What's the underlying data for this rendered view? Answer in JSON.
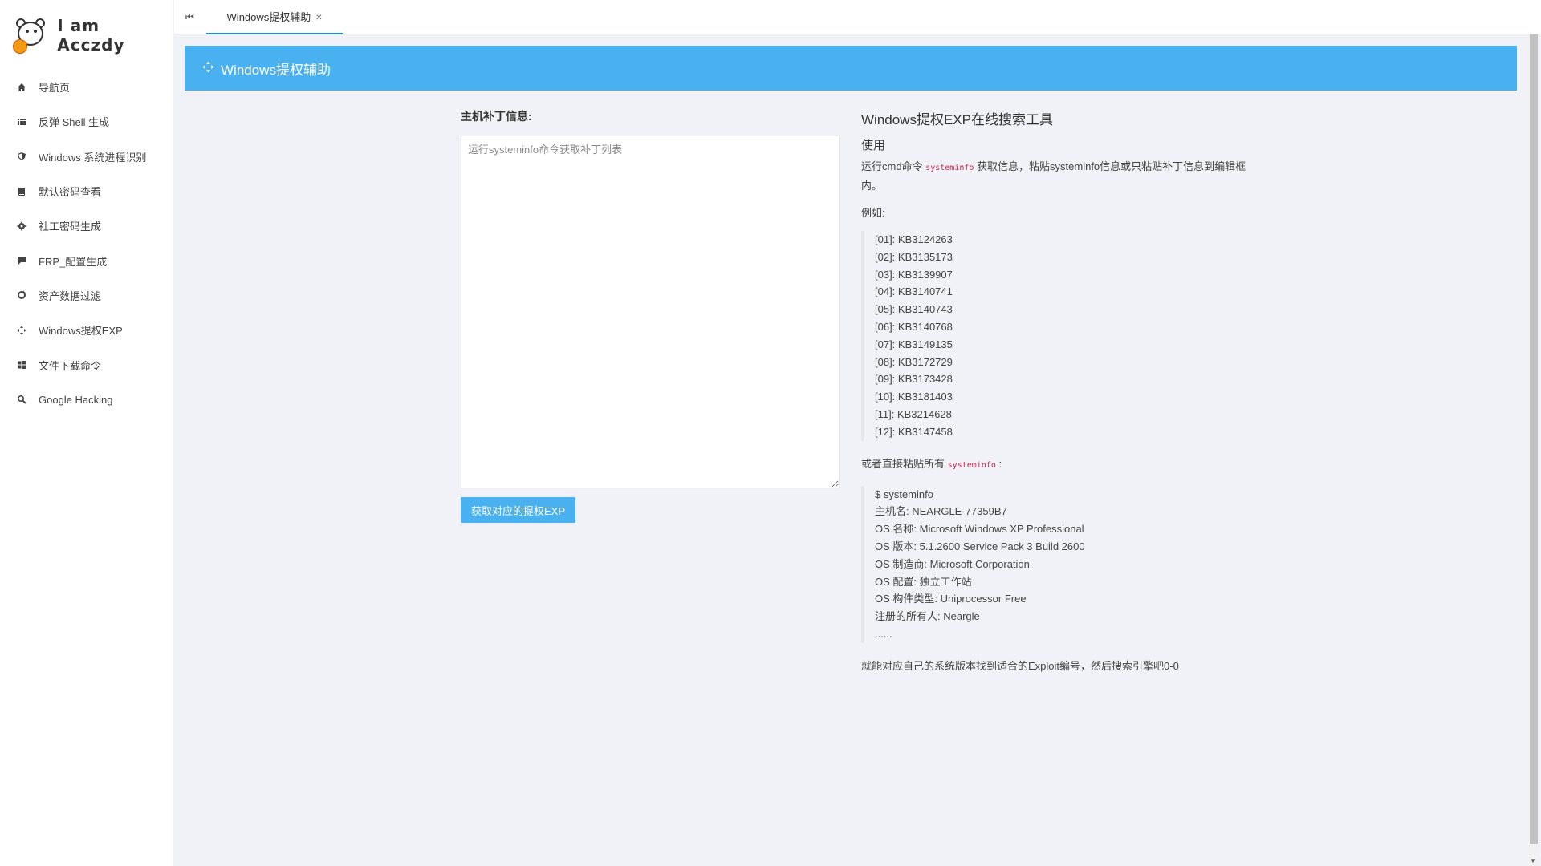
{
  "brand": {
    "logo_text": "I am Acczdy"
  },
  "sidebar": {
    "items": [
      {
        "label": "导航页",
        "icon": "home-icon"
      },
      {
        "label": "反弹 Shell 生成",
        "icon": "list-icon"
      },
      {
        "label": "Windows 系统进程识别",
        "icon": "shield-icon"
      },
      {
        "label": "默认密码查看",
        "icon": "book-icon"
      },
      {
        "label": "社工密码生成",
        "icon": "gear-icon"
      },
      {
        "label": "FRP_配置生成",
        "icon": "chat-icon"
      },
      {
        "label": "资产数据过滤",
        "icon": "refresh-icon"
      },
      {
        "label": "Windows提权EXP",
        "icon": "diamond-arrows-icon"
      },
      {
        "label": "文件下载命令",
        "icon": "windows-icon"
      },
      {
        "label": "Google Hacking",
        "icon": "search-icon"
      }
    ]
  },
  "tabs": {
    "back_icon": "skip-back-icon",
    "active": "Windows提权辅助",
    "close": "×"
  },
  "banner": {
    "title": "Windows提权辅助"
  },
  "form": {
    "label": "主机补丁信息:",
    "placeholder": "运行systeminfo命令获取补丁列表",
    "submit_label": "获取对应的提权EXP"
  },
  "help": {
    "title": "Windows提权EXP在线搜索工具",
    "subtitle": "使用",
    "intro_pre": "运行cmd命令",
    "intro_code": "systeminfo",
    "intro_post": "获取信息，粘贴systeminfo信息或只粘贴补丁信息到编辑框内。",
    "example_label": "例如:",
    "kb_list": [
      "[01]: KB3124263",
      "[02]: KB3135173",
      "[03]: KB3139907",
      "[04]: KB3140741",
      "[05]: KB3140743",
      "[06]: KB3140768",
      "[07]: KB3149135",
      "[08]: KB3172729",
      "[09]: KB3173428",
      "[10]: KB3181403",
      "[11]: KB3214628",
      "[12]: KB3147458"
    ],
    "alt_pre": "或者直接粘贴所有",
    "alt_code": "systeminfo",
    "alt_post": ":",
    "sysinfo": [
      "$ systeminfo",
      "主机名: NEARGLE-77359B7",
      "OS 名称: Microsoft Windows XP Professional",
      "OS 版本: 5.1.2600 Service Pack 3 Build 2600",
      "OS 制造商: Microsoft Corporation",
      "OS 配置: 独立工作站",
      "OS 构件类型: Uniprocessor Free",
      "注册的所有人: Neargle",
      "......"
    ],
    "outro": "就能对应自己的系统版本找到适合的Exploit编号，然后搜索引擎吧0-0"
  },
  "colors": {
    "accent": "#4ab1f0",
    "code": "#c7254e"
  }
}
